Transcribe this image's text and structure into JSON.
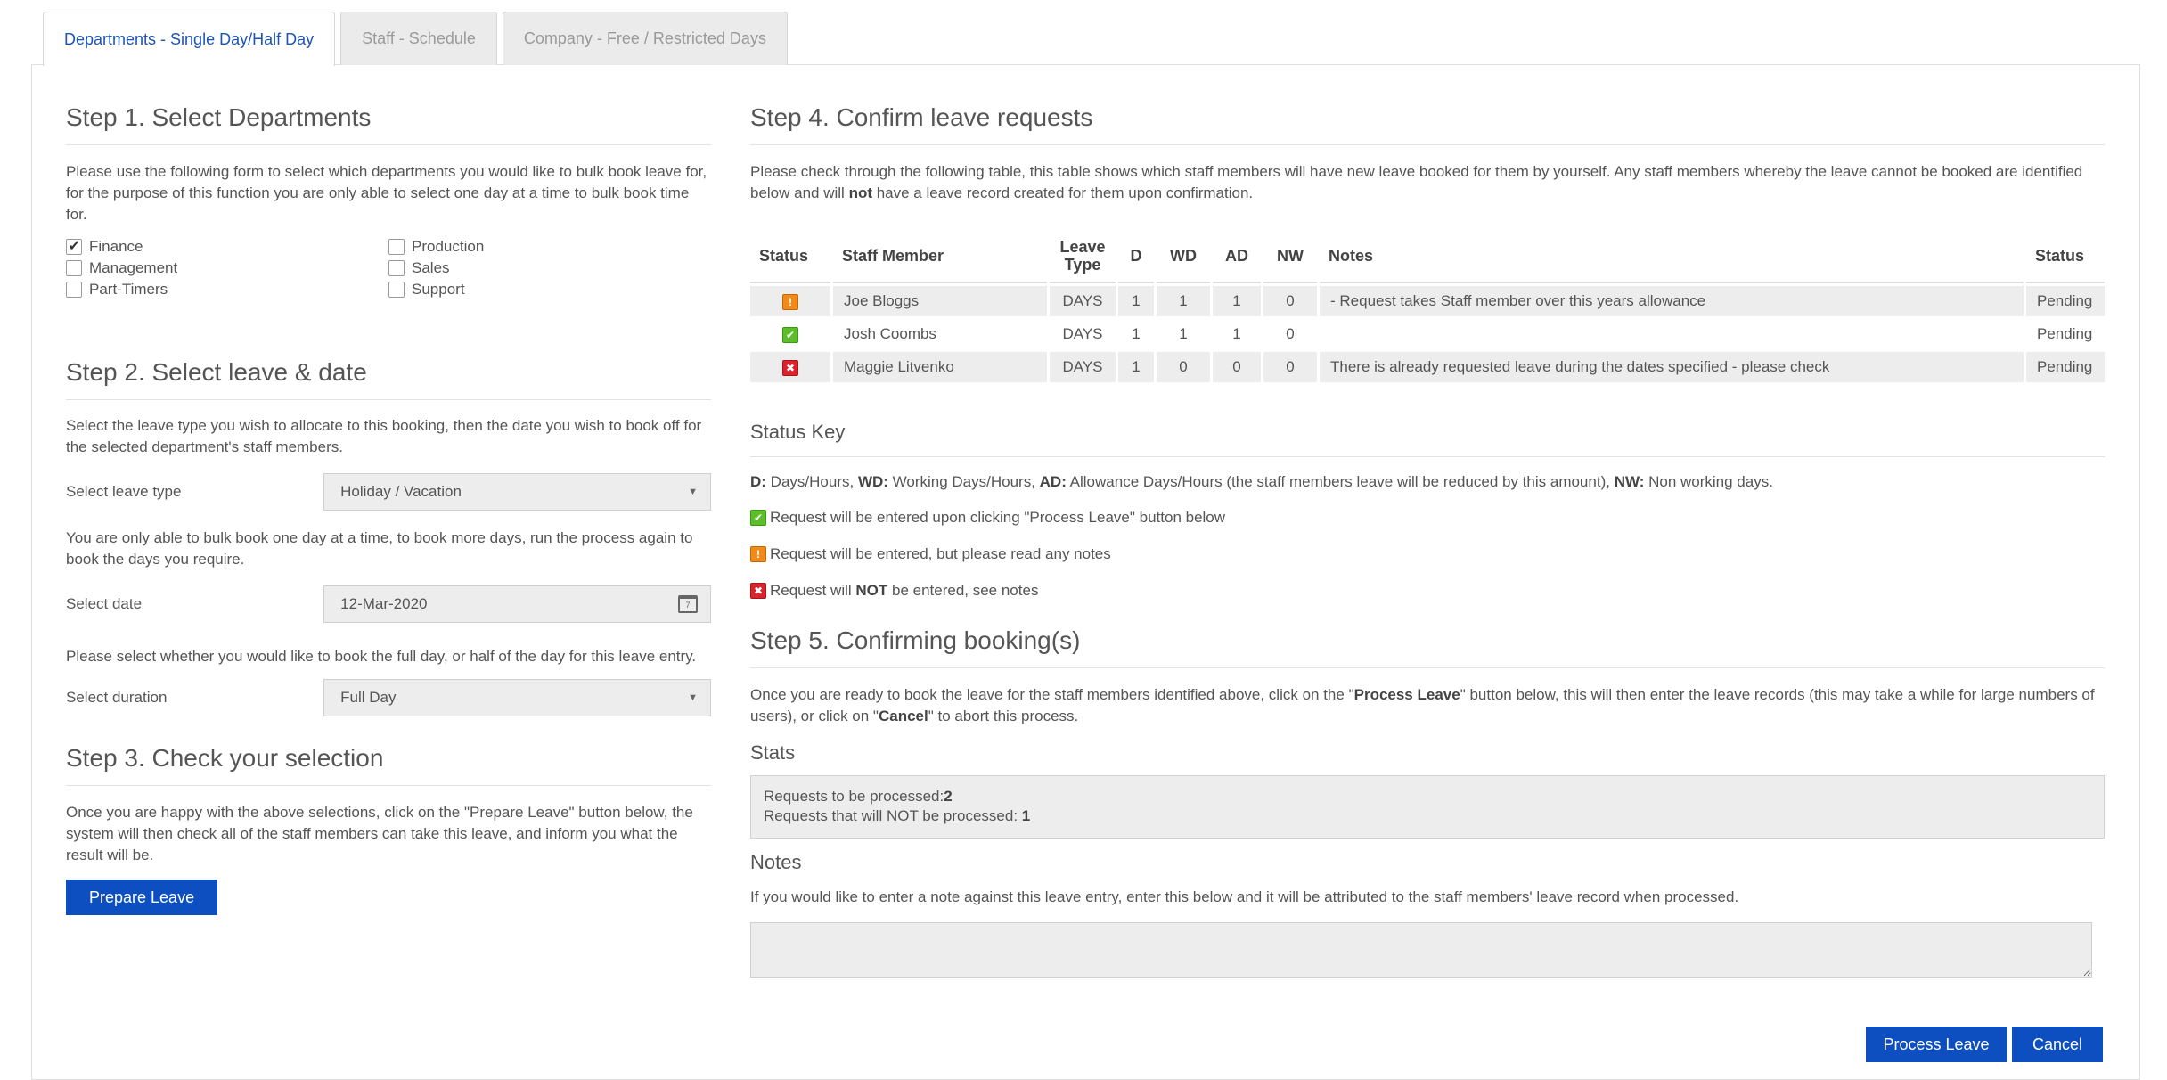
{
  "tabs": [
    {
      "label": "Departments - Single Day/Half Day",
      "active": true
    },
    {
      "label": "Staff - Schedule",
      "active": false
    },
    {
      "label": "Company - Free / Restricted Days",
      "active": false
    }
  ],
  "step1": {
    "title": "Step 1. Select Departments",
    "description": "Please use the following form to select which departments you would like to bulk book leave for, for the purpose of this function you are only able to select one day at a time to bulk book time for.",
    "departments": [
      {
        "label": "Finance",
        "checked": true
      },
      {
        "label": "Production",
        "checked": false
      },
      {
        "label": "Management",
        "checked": false
      },
      {
        "label": "Sales",
        "checked": false
      },
      {
        "label": "Part-Timers",
        "checked": false
      },
      {
        "label": "Support",
        "checked": false
      }
    ]
  },
  "step2": {
    "title": "Step 2. Select leave & date",
    "intro": "Select the leave type you wish to allocate to this booking, then the date you wish to book off for the selected department's staff members.",
    "leave_type_label": "Select leave type",
    "leave_type_value": "Holiday / Vacation",
    "date_note": "You are only able to bulk book one day at a time, to book more days, run the process again to book the days you require.",
    "date_label": "Select date",
    "date_value": "12-Mar-2020",
    "duration_note": "Please select whether you would like to book the full day, or half of the day for this leave entry.",
    "duration_label": "Select duration",
    "duration_value": "Full Day"
  },
  "step3": {
    "title": "Step 3. Check your selection",
    "description": "Once you are happy with the above selections, click on the \"Prepare Leave\" button below, the system will then check all of the staff members can take this leave, and inform you what the result will be.",
    "button": "Prepare Leave"
  },
  "step4": {
    "title": "Step 4. Confirm leave requests",
    "desc_pre": "Please check through the following table, this table shows which staff members will have new leave booked for them by yourself. Any staff members whereby the leave cannot be booked are identified below and will ",
    "desc_bold": "not",
    "desc_post": " have a leave record created for them upon confirmation.",
    "columns": {
      "status": "Status",
      "staff": "Staff Member",
      "leave_type_1": "Leave",
      "leave_type_2": "Type",
      "d": "D",
      "wd": "WD",
      "ad": "AD",
      "nw": "NW",
      "notes": "Notes",
      "status2": "Status"
    },
    "rows": [
      {
        "icon": "warning-icon",
        "staff": "Joe Bloggs",
        "type": "DAYS",
        "d": "1",
        "wd": "1",
        "ad": "1",
        "nw": "0",
        "notes": "- Request takes Staff member over this years allowance",
        "status": "Pending"
      },
      {
        "icon": "ok-icon",
        "staff": "Josh Coombs",
        "type": "DAYS",
        "d": "1",
        "wd": "1",
        "ad": "1",
        "nw": "0",
        "notes": "",
        "status": "Pending"
      },
      {
        "icon": "error-icon",
        "staff": "Maggie Litvenko",
        "type": "DAYS",
        "d": "1",
        "wd": "0",
        "ad": "0",
        "nw": "0",
        "notes": "There is already requested leave during the dates specified - please check",
        "status": "Pending"
      }
    ]
  },
  "status_key": {
    "title": "Status Key",
    "legend": {
      "d_abbr": "D:",
      "d_text": " Days/Hours, ",
      "wd_abbr": "WD:",
      "wd_text": " Working Days/Hours, ",
      "ad_abbr": "AD:",
      "ad_text": " Allowance Days/Hours (the staff members leave will be reduced by this amount), ",
      "nw_abbr": "NW:",
      "nw_text": " Non working days."
    },
    "ok_text": "Request will be entered upon clicking \"Process Leave\" button below",
    "warn_text": "Request will be entered, but please read any notes",
    "err_pre": "Request will ",
    "err_bold": "NOT",
    "err_post": " be entered, see notes"
  },
  "step5": {
    "title": "Step 5. Confirming booking(s)",
    "desc_pre": "Once you are ready to book the leave for the staff members identified above, click on the \"",
    "desc_bold1": "Process Leave",
    "desc_mid": "\" button below, this will then enter the leave records (this may take a while for large numbers of users), or click on \"",
    "desc_bold2": "Cancel",
    "desc_post": "\" to abort this process.",
    "stats_title": "Stats",
    "stats_processed_label": "Requests to be processed:",
    "stats_processed_value": "2",
    "stats_not_label": "Requests that will NOT be processed: ",
    "stats_not_value": "1",
    "notes_title": "Notes",
    "notes_desc": "If you would like to enter a note against this leave entry, enter this below and it will be attributed to the staff members' leave record when processed.",
    "notes_value": "",
    "process_button": "Process Leave",
    "cancel_button": "Cancel"
  },
  "colors": {
    "accent": "#0d4fc1",
    "tab_active_text": "#1d56b5",
    "warning": "#f08a1d",
    "ok": "#5cbf2a",
    "error": "#d9242c"
  }
}
